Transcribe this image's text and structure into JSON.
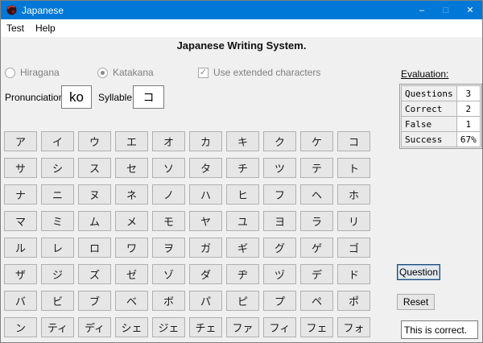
{
  "window": {
    "title": "Japanese",
    "controls": {
      "minimize": "–",
      "maximize": "□",
      "close": "✕"
    }
  },
  "menubar": {
    "items": [
      {
        "label": "Test"
      },
      {
        "label": "Help"
      }
    ]
  },
  "header": {
    "title": "Japanese Writing System."
  },
  "options": {
    "radios": [
      {
        "label": "Hiragana",
        "selected": false,
        "disabled": true
      },
      {
        "label": "Katakana",
        "selected": true,
        "disabled": true
      }
    ],
    "checkbox": {
      "label": "Use extended characters",
      "checked": true,
      "disabled": true,
      "checkmark": "✓"
    }
  },
  "prompt": {
    "pronunciation_label": "Pronunciation",
    "pronunciation_value": "ko",
    "syllable_label": "Syllable",
    "syllable_value": "コ"
  },
  "evaluation": {
    "title": "Evaluation:",
    "rows": [
      {
        "label": "Questions",
        "value": "3"
      },
      {
        "label": "Correct",
        "value": "2"
      },
      {
        "label": "False",
        "value": "1"
      },
      {
        "label": "Success",
        "value": "67%"
      }
    ]
  },
  "keyboard": {
    "rows": [
      [
        "ア",
        "イ",
        "ウ",
        "エ",
        "オ",
        "カ",
        "キ",
        "ク",
        "ケ",
        "コ"
      ],
      [
        "サ",
        "シ",
        "ス",
        "セ",
        "ソ",
        "タ",
        "チ",
        "ツ",
        "テ",
        "ト"
      ],
      [
        "ナ",
        "ニ",
        "ヌ",
        "ネ",
        "ノ",
        "ハ",
        "ヒ",
        "フ",
        "ヘ",
        "ホ"
      ],
      [
        "マ",
        "ミ",
        "ム",
        "メ",
        "モ",
        "ヤ",
        "ユ",
        "ヨ",
        "ラ",
        "リ"
      ],
      [
        "ル",
        "レ",
        "ロ",
        "ワ",
        "ヲ",
        "ガ",
        "ギ",
        "グ",
        "ゲ",
        "ゴ"
      ],
      [
        "ザ",
        "ジ",
        "ズ",
        "ゼ",
        "ゾ",
        "ダ",
        "ヂ",
        "ヅ",
        "デ",
        "ド"
      ],
      [
        "バ",
        "ビ",
        "ブ",
        "ベ",
        "ボ",
        "パ",
        "ピ",
        "プ",
        "ペ",
        "ポ"
      ],
      [
        "ン",
        "ティ",
        "ディ",
        "シェ",
        "ジェ",
        "チェ",
        "ファ",
        "フィ",
        "フェ",
        "フォ"
      ]
    ]
  },
  "actions": {
    "question_label": "Question",
    "reset_label": "Reset"
  },
  "feedback": {
    "message": "This is correct."
  },
  "colors": {
    "titlebar": "#0078d7",
    "titlebar_text": "#ffffff",
    "content_bg": "#f0f0f0",
    "button_bg": "#e6e6e6",
    "button_border": "#b0b0b0",
    "default_button_border": "#1c4a75",
    "disabled_text": "#7f7f7f"
  }
}
